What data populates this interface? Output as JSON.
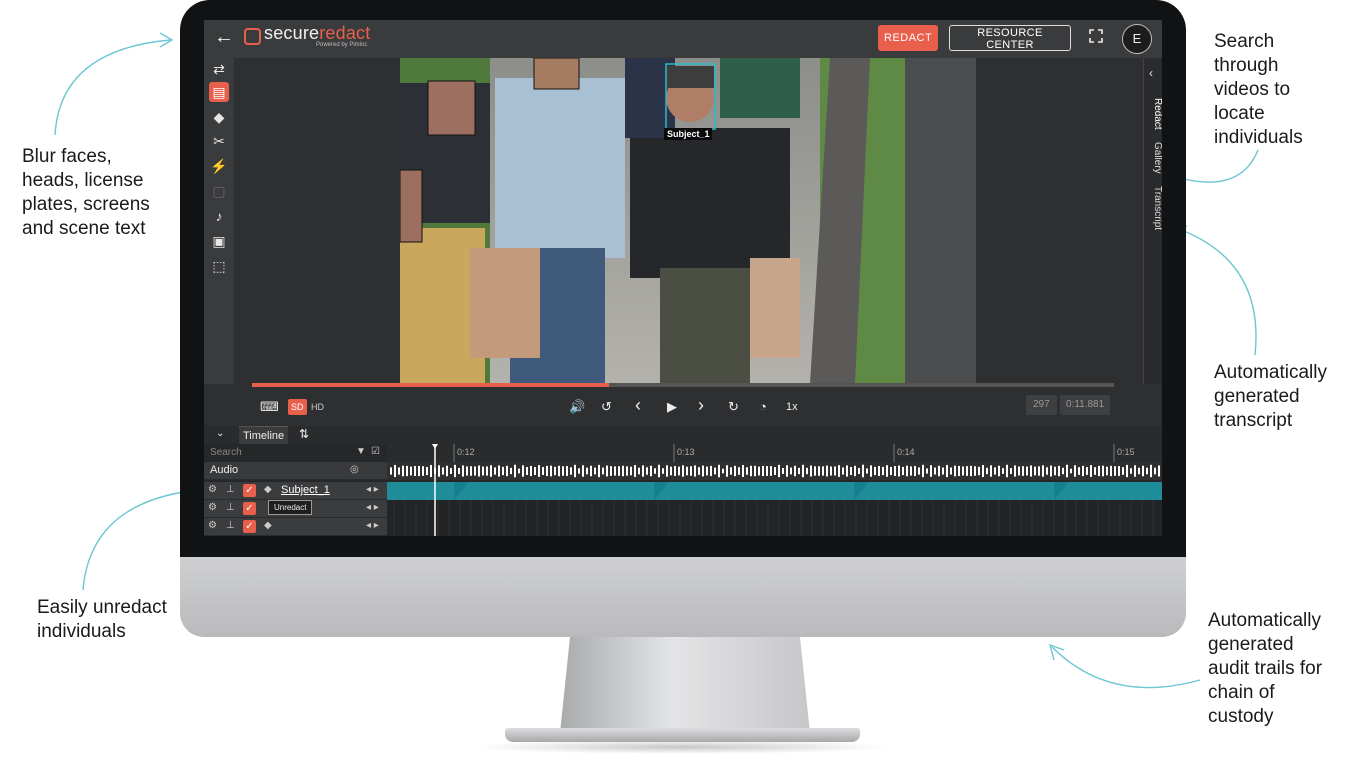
{
  "callouts": {
    "blur": [
      "Blur faces,",
      "heads, license",
      "plates, screens",
      "and scene text"
    ],
    "unredact": [
      "Easily unredact",
      "individuals"
    ],
    "search": [
      "Search",
      "through",
      "videos to",
      "locate",
      "individuals"
    ],
    "transcript": [
      "Automatically",
      "generated",
      "transcript"
    ],
    "audit": [
      "Automatically",
      "generated",
      "audit trails for",
      "chain of",
      "custody"
    ]
  },
  "app": {
    "logo_part1": "secure",
    "logo_part2": "redact",
    "logo_sub": "Powered by Pimloc",
    "redact_label": "REDACT",
    "resource_label": "RESOURCE CENTER",
    "avatar_initial": "E"
  },
  "video": {
    "subject_label": "Subject_1"
  },
  "side_tabs": [
    "Redact",
    "Gallery",
    "Transcript"
  ],
  "playback": {
    "progress": 0.414,
    "sd_label": "SD",
    "hd_label": "HD",
    "speed": "1x",
    "frame": "297",
    "time": "0:11.881"
  },
  "timeline": {
    "tab_label": "Timeline",
    "search_placeholder": "Search",
    "ticks": [
      "0:12",
      "0:13",
      "0:14",
      "0:15"
    ],
    "audio_label": "Audio",
    "track_name": "Subject_1",
    "tooltip": "Unredact"
  },
  "colors": {
    "accent": "#e8604c",
    "track": "#1f8c9a",
    "callout_arrow": "#6cc6d3"
  }
}
